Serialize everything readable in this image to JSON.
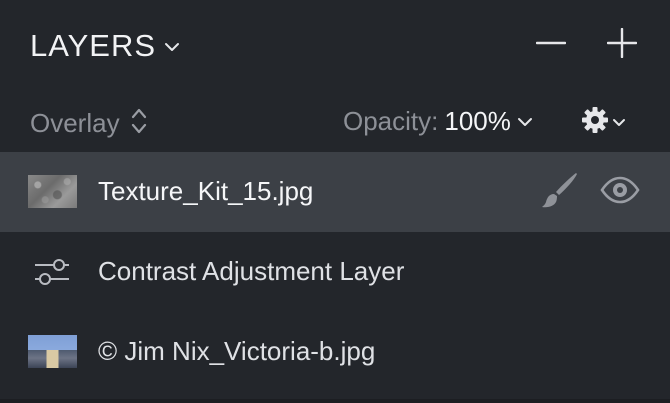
{
  "panel": {
    "title": "LAYERS",
    "blend_mode": "Overlay",
    "opacity_label": "Opacity:",
    "opacity_value": "100%"
  },
  "icons": {
    "title_dropdown": "chevron-down-icon",
    "remove_layer": "minus-icon",
    "add_layer": "plus-icon",
    "blend_selector": "up-down-chevron-icon",
    "opacity_dropdown": "chevron-down-icon",
    "settings": "gear-icon",
    "paint_mask": "brush-icon",
    "visibility": "eye-icon",
    "adjustment": "sliders-icon"
  },
  "layers": [
    {
      "name": "Texture_Kit_15.jpg",
      "type": "image",
      "thumbnail": "texture",
      "selected": true
    },
    {
      "name": "Contrast Adjustment Layer",
      "type": "adjustment",
      "selected": false
    },
    {
      "name": "© Jim Nix_Victoria-b.jpg",
      "type": "image",
      "thumbnail": "photo",
      "selected": false
    }
  ],
  "colors": {
    "panel_bg": "#23262b",
    "selected_row_bg": "#3c4046",
    "muted_text": "#8d9097",
    "primary_text": "#f4f5f7"
  }
}
